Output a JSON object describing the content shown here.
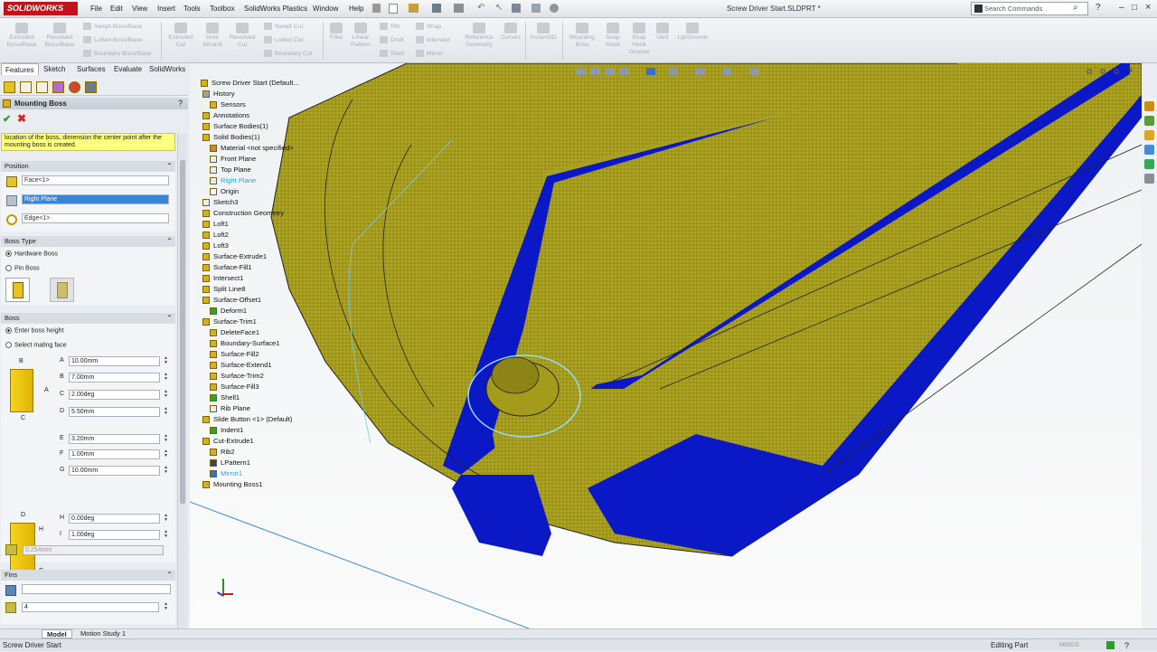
{
  "app": {
    "logo": "SOLIDWORKS",
    "doc_title": "Screw Driver Start.SLDPRT *"
  },
  "menu": [
    "File",
    "Edit",
    "View",
    "Insert",
    "Tools",
    "Toolbox",
    "SolidWorks Plastics",
    "Window",
    "Help"
  ],
  "search": {
    "placeholder": "Search Commands"
  },
  "toolbar": {
    "extruded_boss": "Extruded Boss/Base",
    "revolved_boss": "Revolved Boss/Base",
    "swept_boss": "Swept Boss/Base",
    "lofted_boss": "Lofted Boss/Base",
    "boundary_boss": "Boundary Boss/Base",
    "extruded_cut": "Extruded Cut",
    "hole_wizard": "Hole Wizard",
    "revolved_cut": "Revolved Cut",
    "swept_cut": "Swept Cut",
    "lofted_cut": "Lofted Cut",
    "boundary_cut": "Boundary Cut",
    "fillet": "Fillet",
    "linear_pattern": "Linear Pattern",
    "rib": "Rib",
    "draft": "Draft",
    "shell": "Shell",
    "wrap": "Wrap",
    "intersect": "Intersect",
    "mirror": "Mirror",
    "reference_geometry": "Reference Geometry",
    "curves": "Curves",
    "instant3d": "Instant3D",
    "mounting_boss": "Mounting Boss",
    "snap_hook": "Snap Hook",
    "snap_hook_groove": "Snap Hook Groove",
    "vent": "Vent",
    "lip_groove": "Lip/Groove"
  },
  "cm_tabs": [
    "Features",
    "Sketch",
    "Surfaces",
    "Evaluate",
    "SolidWorks Plastics"
  ],
  "pm": {
    "title": "Mounting Boss",
    "message": "location of the boss, dimension the center point after the mounting boss is created.",
    "position": {
      "header": "Position",
      "face": "Face<1>",
      "plane": "Right Plane",
      "edge": "Edge<1>"
    },
    "boss_type": {
      "header": "Boss Type",
      "opt1": "Hardware Boss",
      "opt2": "Pin Boss"
    },
    "boss": {
      "header": "Boss",
      "opt1": "Enter boss height",
      "opt2": "Select mating face",
      "A": "10.00mm",
      "B": "7.00mm",
      "C": "2.00deg",
      "D": "5.50mm",
      "E": "3.20mm",
      "F": "1.00mm",
      "G": "10.00mm",
      "H": "0.00deg",
      "I": "1.00deg",
      "clearance": "0.254mm",
      "labels": {
        "A": "A",
        "B": "B",
        "C": "C",
        "D": "D",
        "E": "E",
        "F": "F",
        "G": "G",
        "H": "H",
        "I": "I"
      }
    },
    "fins": {
      "header": "Fins",
      "count": "4"
    }
  },
  "tree": {
    "root": "Screw Driver Start  (Default...",
    "items": [
      "History",
      "Sensors",
      "Annotations",
      "Surface Bodies(1)",
      "Solid Bodies(1)",
      "Material <not specified>",
      "Front Plane",
      "Top Plane",
      "Right Plane",
      "Origin",
      "Sketch3",
      "Construction Geometry",
      "Loft1",
      "Loft2",
      "Loft3",
      "Surface-Extrude1",
      "Surface-Fill1",
      "Intersect1",
      "Split Line8",
      "Surface-Offset1",
      "Deform1",
      "Surface-Trim1",
      "DeleteFace1",
      "Boundary-Surface1",
      "Surface-Fill2",
      "Surface-Extend1",
      "Surface-Trim2",
      "Surface-Fill3",
      "Shell1",
      "Rib Plane",
      "Slide Button <1> (Default)",
      "Indent1",
      "Cut-Extrude1",
      "Rib2",
      "LPattern1",
      "Mirror1",
      "Mounting Boss1"
    ]
  },
  "bottom_tabs": [
    "Model",
    "Motion Study 1"
  ],
  "status": {
    "left": "Screw Driver Start",
    "mode": "Editing Part",
    "units": "MMGS"
  },
  "colors": {
    "accent": "#c2131a",
    "surface": "#a8a022",
    "cut": "#0a17c8",
    "selected": "#3a84d8"
  }
}
